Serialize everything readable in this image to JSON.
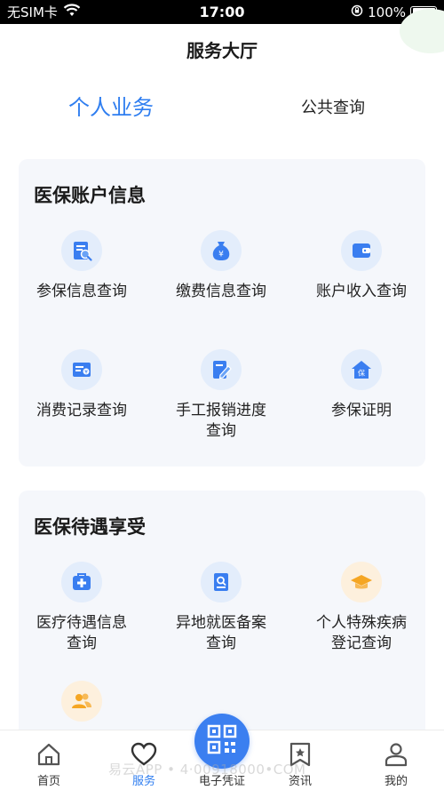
{
  "status_bar": {
    "carrier": "无SIM卡",
    "time": "17:00",
    "battery": "100%"
  },
  "header": {
    "title": "服务大厅"
  },
  "tabs": [
    {
      "label": "个人业务",
      "active": true
    },
    {
      "label": "公共查询",
      "active": false
    }
  ],
  "sections": [
    {
      "title": "医保账户信息",
      "items": [
        {
          "label": "参保信息查询",
          "icon": "document-search-icon"
        },
        {
          "label": "缴费信息查询",
          "icon": "money-bag-icon"
        },
        {
          "label": "账户收入查询",
          "icon": "wallet-icon"
        },
        {
          "label": "消费记录查询",
          "icon": "bill-icon"
        },
        {
          "label": "手工报销进度查询",
          "icon": "edit-document-icon"
        },
        {
          "label": "参保证明",
          "icon": "insurance-house-icon"
        }
      ]
    },
    {
      "title": "医保待遇享受",
      "items": [
        {
          "label": "医疗待遇信息查询",
          "icon": "medical-kit-icon"
        },
        {
          "label": "异地就医备案查询",
          "icon": "search-file-icon"
        },
        {
          "label": "个人特殊疾病登记查询",
          "icon": "graduation-cap-icon"
        },
        {
          "label": "",
          "icon": "people-icon"
        }
      ]
    }
  ],
  "bottom_nav": [
    {
      "label": "首页",
      "icon": "home-icon",
      "active": false
    },
    {
      "label": "服务",
      "icon": "heart-icon",
      "active": true
    },
    {
      "label": "电子凭证",
      "icon": "qr-code-icon",
      "active": false
    },
    {
      "label": "资讯",
      "icon": "bookmark-star-icon",
      "active": false
    },
    {
      "label": "我的",
      "icon": "person-icon",
      "active": false
    }
  ],
  "watermark": "易云APP • 4·00918000•COM",
  "colors": {
    "accent": "#2f7ef0",
    "card_bg": "#f5f7fb",
    "icon_bg": "#e3edfb",
    "orange_icon": "#f5a623"
  }
}
